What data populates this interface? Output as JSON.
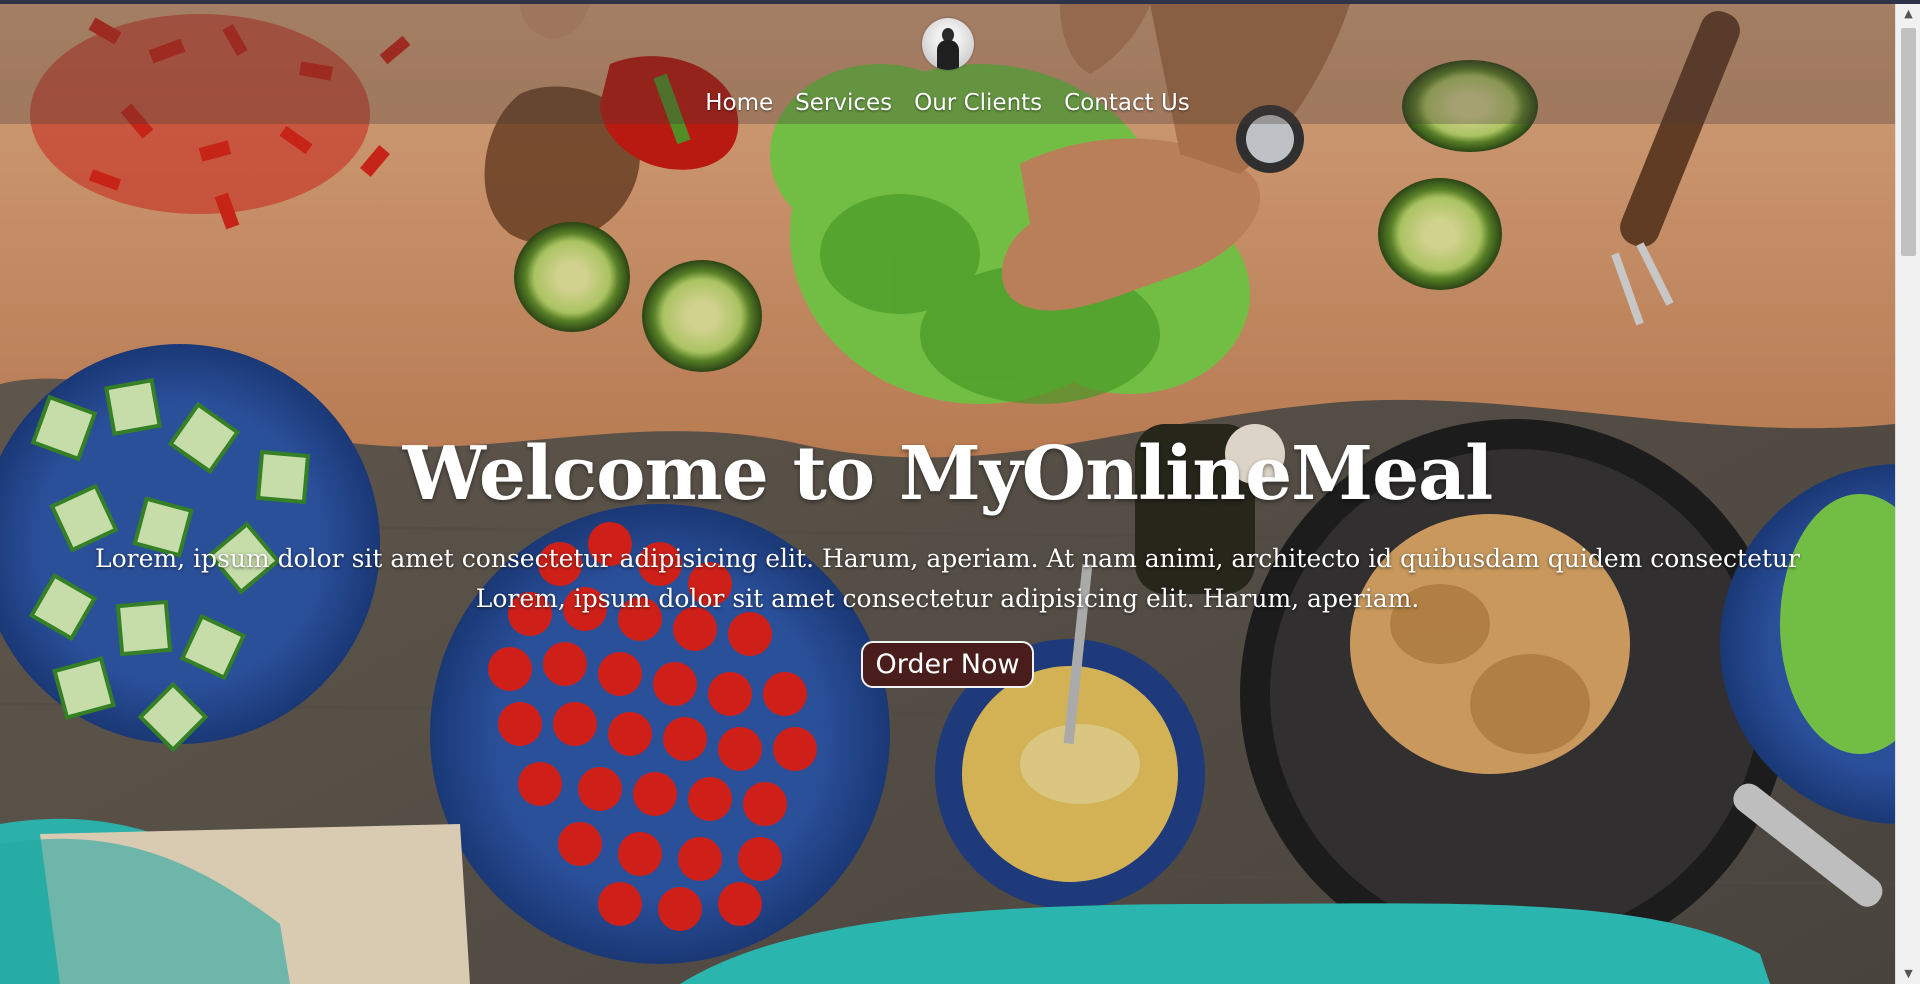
{
  "nav": {
    "items": [
      {
        "label": "Home"
      },
      {
        "label": "Services"
      },
      {
        "label": "Our Clients"
      },
      {
        "label": "Contact Us"
      }
    ]
  },
  "hero": {
    "title": "Welcome to MyOnlineMeal",
    "line1": "Lorem, ipsum dolor sit amet consectetur adipisicing elit. Harum, aperiam. At nam animi, architecto id quibusdam quidem consectetur",
    "line2": "Lorem, ipsum dolor sit amet consectetur adipisicing elit. Harum, aperiam.",
    "button_label": "Order Now"
  },
  "colors": {
    "button_bg": "#4a1d1d",
    "topbar": "#2e3348"
  },
  "icons": {
    "logo": "person-silhouette-logo"
  }
}
